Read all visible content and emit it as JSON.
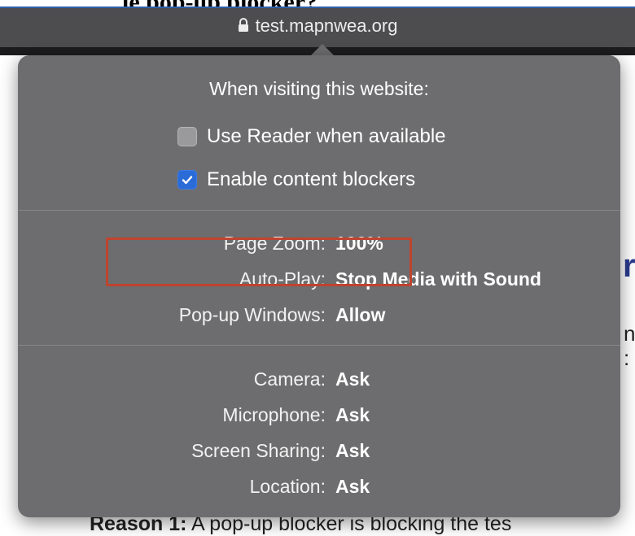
{
  "page": {
    "heading_fragment": "le pop-up blocker? ",
    "right_glyph": "r",
    "right_text_1": "n",
    "right_text_2": ":",
    "reason_bold": "Reason 1:",
    "reason_text": " A pop-up blocker is blocking the tes"
  },
  "addressbar": {
    "url": "test.mapnwea.org",
    "lock_icon": "lock-icon"
  },
  "popover": {
    "heading": "When visiting this website:",
    "options": [
      {
        "label": "Use Reader when available",
        "checked": false
      },
      {
        "label": "Enable content blockers",
        "checked": true
      }
    ],
    "settings_group1": [
      {
        "label": "Page Zoom:",
        "value": "100%"
      },
      {
        "label": "Auto-Play:",
        "value": "Stop Media with Sound"
      },
      {
        "label": "Pop-up Windows:",
        "value": "Allow"
      }
    ],
    "settings_group2": [
      {
        "label": "Camera:",
        "value": "Ask"
      },
      {
        "label": "Microphone:",
        "value": "Ask"
      },
      {
        "label": "Screen Sharing:",
        "value": "Ask"
      },
      {
        "label": "Location:",
        "value": "Ask"
      }
    ]
  },
  "colors": {
    "popover_bg": "#6d6d6f",
    "highlight_box": "#c0432e",
    "checkbox_checked": "#2a6bd8"
  }
}
